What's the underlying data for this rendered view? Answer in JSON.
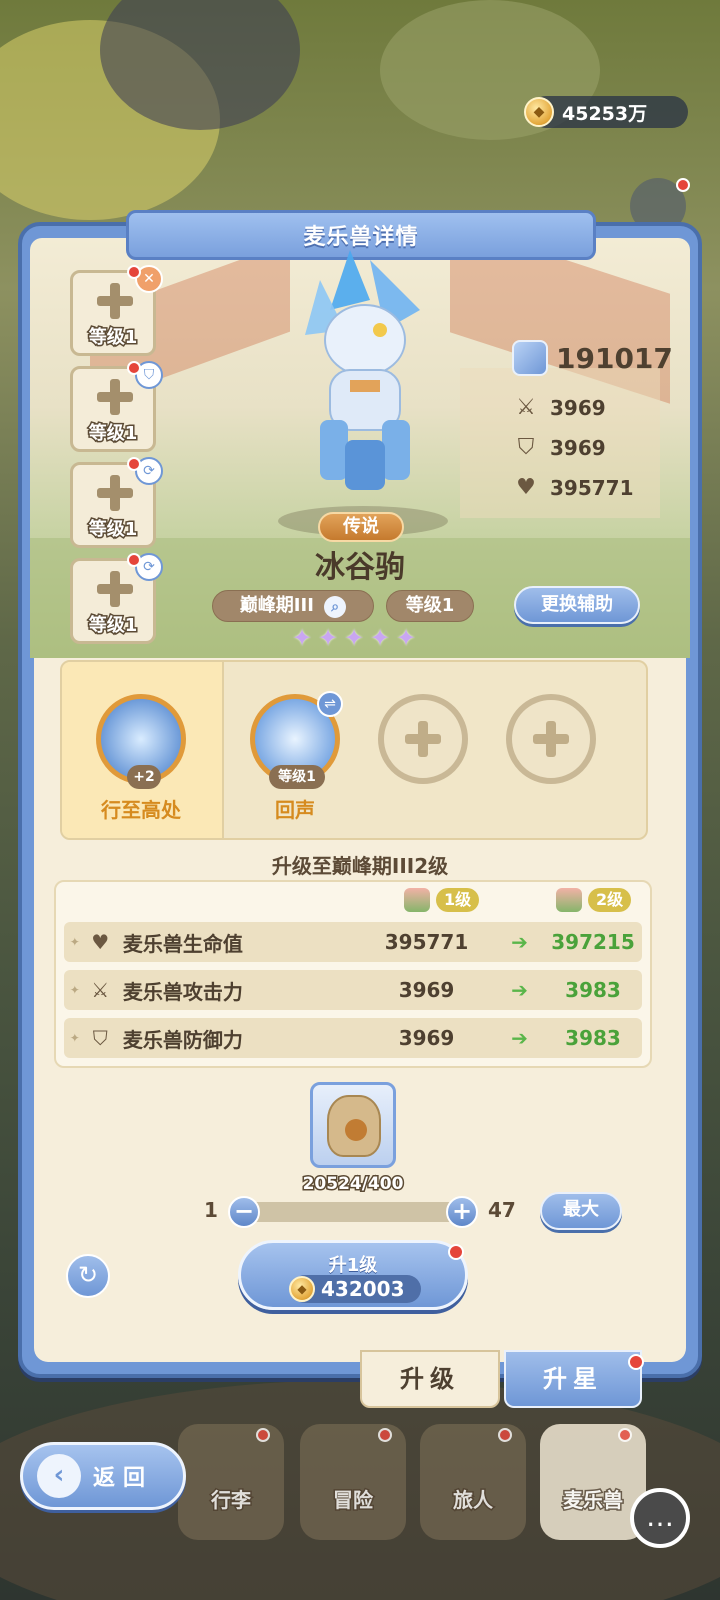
{
  "currency": {
    "icon": "coin-icon",
    "value": "45253万"
  },
  "panel": {
    "title": "麦乐兽详情"
  },
  "skill_slots": [
    {
      "label": "等级1",
      "badge_icon": "crossed-swords-icon"
    },
    {
      "label": "等级1",
      "badge_icon": "shield-icon"
    },
    {
      "label": "等级1",
      "badge_icon": "swirl-icon"
    },
    {
      "label": "等级1",
      "badge_icon": "swirl-icon"
    }
  ],
  "pet": {
    "rarity": "传说",
    "name": "冰谷驹",
    "tier": "巅峰期III",
    "level": "等级1",
    "stars": 5,
    "change_button": "更换辅助"
  },
  "power": {
    "value": "191017"
  },
  "stats": {
    "attack": "3969",
    "defense": "3969",
    "hp": "395771"
  },
  "abilities": [
    {
      "name": "行至高处",
      "badge": "+2",
      "selected": true
    },
    {
      "name": "回声",
      "badge": "等级1",
      "selected": false
    },
    {
      "empty": true
    },
    {
      "empty": true
    }
  ],
  "upgrade": {
    "title": "升级至巅峰期III2级",
    "from_level": "1级",
    "to_level": "2级",
    "rows": [
      {
        "icon": "heart-icon",
        "name": "麦乐兽生命值",
        "old": "395771",
        "new": "397215"
      },
      {
        "icon": "crossed-swords-icon",
        "name": "麦乐兽攻击力",
        "old": "3969",
        "new": "3983"
      },
      {
        "icon": "shield-icon",
        "name": "麦乐兽防御力",
        "old": "3969",
        "new": "3983"
      }
    ]
  },
  "material": {
    "icon": "food-sack-icon",
    "count": "20524/400"
  },
  "quantity": {
    "min": "1",
    "max": "47",
    "minus": "−",
    "plus": "+",
    "max_button": "最大"
  },
  "upgrade_button": {
    "label": "升1级",
    "cost": "432003"
  },
  "tabs": {
    "upgrade": "升级",
    "star": "升星"
  },
  "nav": [
    "行李",
    "冒险",
    "旅人",
    "麦乐兽"
  ],
  "back_button": "返回",
  "colors": {
    "accent": "#6f97d6",
    "green": "#4aa23a",
    "gold": "#d68b1f",
    "alert": "#e5453a"
  }
}
